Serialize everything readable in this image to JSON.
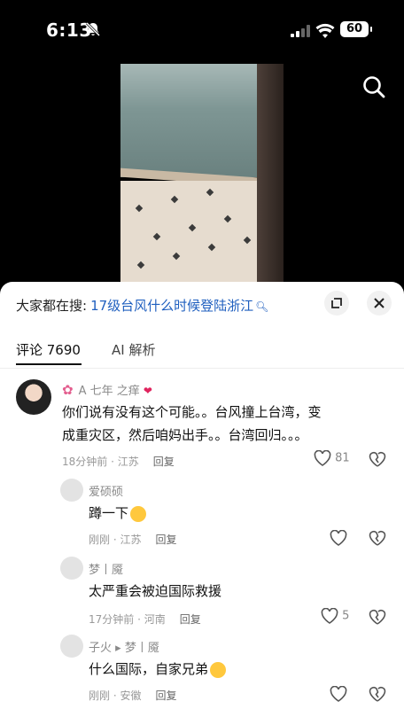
{
  "status_bar": {
    "time": "6:13",
    "battery": "60"
  },
  "search_suggestion": {
    "label": "大家都在搜:",
    "query": "17级台风什么时候登陆浙江",
    "query_icon": "search-arrow-icon"
  },
  "tabs": {
    "comments": "评论 7690",
    "ai": "AI 解析"
  },
  "comments": [
    {
      "user": "A 七年 之痒",
      "text": "你们说有没有这个可能。。台风撞上台湾，变成重灾区，然后咱妈出手。。台湾回归。。。",
      "time": "18分钟前",
      "location": "江苏",
      "reply_label": "回复",
      "likes": "81"
    },
    {
      "user": "爱硕硕",
      "text": "蹲一下",
      "time": "刚刚",
      "location": "江苏",
      "reply_label": "回复",
      "likes": ""
    },
    {
      "user": "梦丨魇",
      "text": "太严重会被迫国际救援",
      "time": "17分钟前",
      "location": "河南",
      "reply_label": "回复",
      "likes": "5"
    },
    {
      "user": "子火",
      "reply_to": "梦丨魇",
      "text": "什么国际，自家兄弟",
      "time": "刚刚",
      "location": "安徽",
      "reply_label": "回复",
      "likes": ""
    }
  ]
}
